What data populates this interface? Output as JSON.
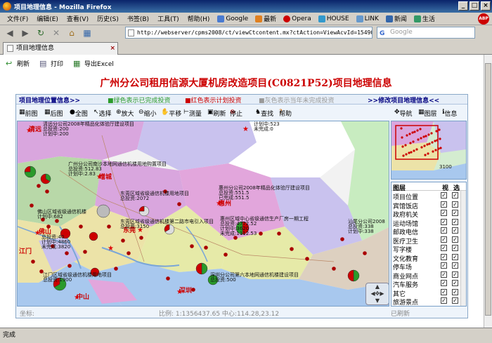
{
  "window": {
    "title": "项目地理信息 - Mozilla Firefox"
  },
  "menu": {
    "items": [
      "文件(F)",
      "编辑(E)",
      "查看(V)",
      "历史(S)",
      "书签(B)",
      "工具(T)",
      "帮助(H)"
    ]
  },
  "bookmarks": [
    {
      "label": "Google",
      "color": "#4a7bd0"
    },
    {
      "label": "最新",
      "color": "#e08020"
    },
    {
      "label": "Opera",
      "color": "#cc0000"
    },
    {
      "label": "HOUSE",
      "color": "#3399cc"
    },
    {
      "label": "LINK",
      "color": "#6699cc"
    },
    {
      "label": "新闻",
      "color": "#3366aa"
    },
    {
      "label": "生活",
      "color": "#339966"
    }
  ],
  "nav": {
    "url": "http://webserver/cpms2008/ct/viewCtcontent.mx?ctAction=ViewAcvId=15490&itemI",
    "search_placeholder": "Google",
    "search_engine": "G"
  },
  "tab": {
    "label": "项目地理信息"
  },
  "page_toolbar": {
    "refresh": "刷新",
    "print": "打印",
    "export": "导出Excel"
  },
  "page_title": "广州分公司租用信源大厦机房改造项目(C0821P52)项目地理信息",
  "info_bar": {
    "left_link": "项目地理位置信息>>",
    "green_legend": "■绿色表示已完成投资",
    "red_legend": "■红色表示计划投资",
    "gray_legend": "■灰色表示当年未完成投资",
    "right_link": ">>修改项目地理信息<<"
  },
  "map_tools": {
    "left": [
      "前图",
      "后图",
      "全图",
      "选择",
      "放大",
      "缩小",
      "平移",
      "测量",
      "刷新",
      "停止",
      "查找",
      "帮助"
    ],
    "right": [
      "导航",
      "图层",
      "信息"
    ]
  },
  "layers": {
    "header": "图层",
    "col_visible": "视",
    "col_select": "选",
    "items": [
      {
        "name": "项目位置",
        "visible": true,
        "select": true
      },
      {
        "name": "宾馆饭店",
        "visible": true,
        "select": true
      },
      {
        "name": "政府机关",
        "visible": true,
        "select": true
      },
      {
        "name": "运动场馆",
        "visible": true,
        "select": true
      },
      {
        "name": "邮政电信",
        "visible": true,
        "select": true
      },
      {
        "name": "医疗卫生",
        "visible": true,
        "select": true
      },
      {
        "name": "写字楼",
        "visible": true,
        "select": true
      },
      {
        "name": "文化教育",
        "visible": true,
        "select": true
      },
      {
        "name": "停车场",
        "visible": true,
        "select": true
      },
      {
        "name": "商业网点",
        "visible": true,
        "select": true
      },
      {
        "name": "汽车服务",
        "visible": true,
        "select": true
      },
      {
        "name": "其它",
        "visible": true,
        "select": true
      },
      {
        "name": "旅游景点",
        "visible": true,
        "select": true
      }
    ]
  },
  "map_status": {
    "coord": "坐标:",
    "scale": "比例: 1:1356437.65 中心:114.28,23.12",
    "loaded": "已刷新"
  },
  "map_labels": {
    "cities": [
      "清远",
      "增城",
      "东莞",
      "佛山",
      "江门",
      "中山",
      "深圳",
      "惠州"
    ],
    "projects": [
      "清远分公司2008年精品化体验厅建设项目",
      "广州分公司南沙本地网通信机楼用地购置项目",
      "东莞区域省级通信机楼用地项目",
      "惠州分公司2008年精品化体验厅建设项目",
      "佛山区域省级通信机楼",
      "东莞区域省级通信机楼第二路市电引入项目",
      "惠州区域中心省级通信生产厂房一期工程",
      "汕尾分公司2008",
      "江门区域省级通信机楼用地项目",
      "深圳分公司第六本地网通信机楼建设项目"
    ],
    "invest_total": "总投资",
    "done": "已完成",
    "plan": "计划中",
    "undone": "未完成",
    "values": [
      "200",
      "200",
      "523",
      "512.83",
      "2.83",
      "2072",
      "551.5",
      "551.5",
      "4772.52",
      "3620",
      "1112.53",
      "3150",
      "40",
      "4860",
      "3820",
      "1900",
      "500",
      "338",
      "338",
      "0",
      "682"
    ]
  },
  "overview_value": "3100",
  "browser_status": "完成"
}
